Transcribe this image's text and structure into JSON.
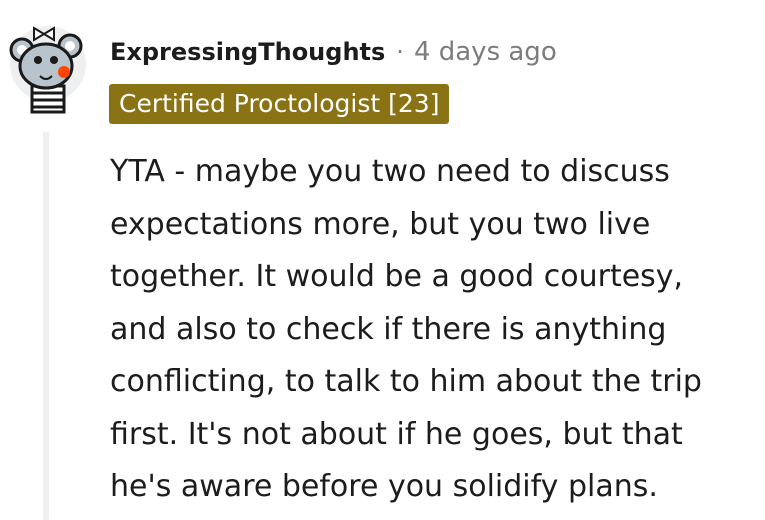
{
  "comment": {
    "author": "ExpressingThoughts",
    "separator": "·",
    "timestamp": "4 days ago",
    "flair": "Certified Proctologist [23]",
    "body_lines": [
      "YTA - maybe you two need to discuss",
      "expectations more, but you two live",
      "together. It would be a good courtesy,",
      "and also to check if there is anything",
      "conflicting, to talk to him about the trip",
      "first. It's not about if he goes, but that",
      "he's aware before you solidify plans."
    ]
  },
  "avatar": {
    "icon": "koala-avatar-icon",
    "colors": {
      "circle": "#dae0e6",
      "fur": "#b8c3cc",
      "nose": "#ff4500",
      "shirt_stripe": "#1a1a1b"
    }
  },
  "colors": {
    "flair_background": "#8a7314",
    "flair_text": "#ffffff",
    "meta_text": "#7c7c7c",
    "body_text": "#1c1c1c",
    "thread_line": "#edeff1"
  }
}
